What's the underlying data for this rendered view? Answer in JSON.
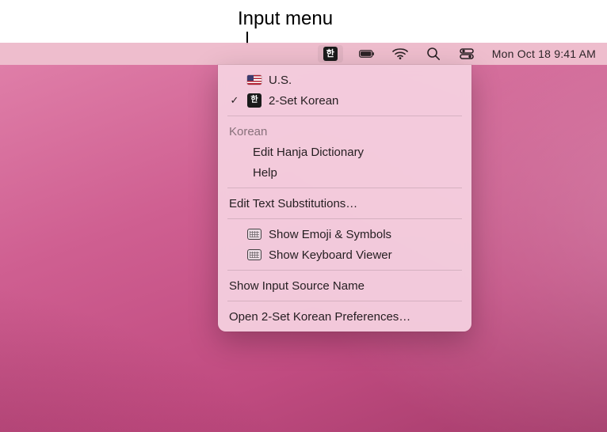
{
  "callout": {
    "label": "Input menu"
  },
  "menubar": {
    "datetime": "Mon Oct 18  9:41 AM"
  },
  "menu": {
    "sources": [
      {
        "label": "U.S.",
        "checked": false,
        "icon": "us-flag"
      },
      {
        "label": "2-Set Korean",
        "checked": true,
        "icon": "han"
      }
    ],
    "section_header": "Korean",
    "section_items": [
      {
        "label": "Edit Hanja Dictionary"
      },
      {
        "label": "Help"
      }
    ],
    "text_subs": "Edit Text Substitutions…",
    "show_emoji": "Show Emoji & Symbols",
    "show_keyboard": "Show Keyboard Viewer",
    "show_input_name": "Show Input Source Name",
    "open_prefs": "Open 2-Set Korean Preferences…"
  }
}
